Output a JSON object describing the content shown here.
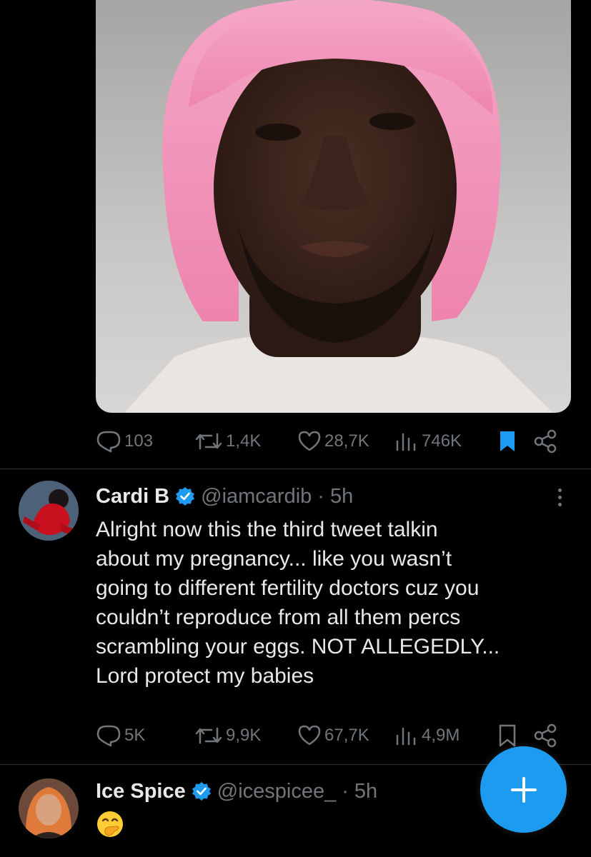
{
  "tweet1": {
    "media_alt": "image",
    "stats": {
      "replies": "103",
      "reposts": "1,4K",
      "likes": "28,7K",
      "views": "746K"
    }
  },
  "tweet2": {
    "name": "Cardi B",
    "handle": "@iamcardib",
    "time": "· 5h",
    "lines": [
      "Alright now this the third tweet talkin",
      "about my pregnancy... like you wasn’t",
      "going to different fertility doctors cuz you",
      "couldn’t reproduce from all them percs",
      "scrambling your eggs. NOT ALLEGEDLY...",
      "Lord protect my babies"
    ],
    "stats": {
      "replies": "5K",
      "reposts": "9,9K",
      "likes": "67,7K",
      "views": "4,9M"
    }
  },
  "tweet3": {
    "name": "Ice Spice",
    "handle": "@icespicee_",
    "time": "· 5h",
    "text": "🤭"
  },
  "colors": {
    "background": "#000000",
    "text": "#e7e9ea",
    "muted": "#71767b",
    "accent": "#1d9bf0",
    "divider": "#2f3336"
  },
  "icons": [
    "reply-icon",
    "repost-icon",
    "like-icon",
    "views-icon",
    "bookmark-icon",
    "share-icon",
    "verified-icon",
    "more-icon",
    "compose-icon"
  ]
}
